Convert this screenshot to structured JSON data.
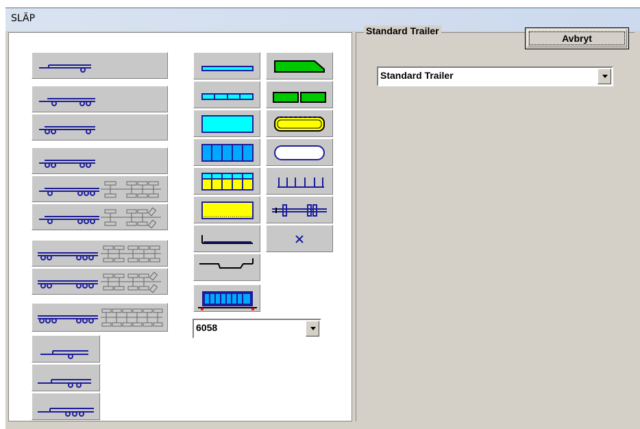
{
  "window": {
    "title": "SLÄP"
  },
  "group": {
    "legend": "Standard Trailer"
  },
  "cancel_button": {
    "label": "Avbryt"
  },
  "trailer_type_select": {
    "value": "Standard Trailer"
  },
  "size_select": {
    "value": "6058"
  },
  "colors": {
    "trailer_blue": "#1c1c9a",
    "cyan": "#00ffff",
    "green": "#00c800",
    "yellow": "#ffff00",
    "button_face": "#c8c8c8"
  }
}
